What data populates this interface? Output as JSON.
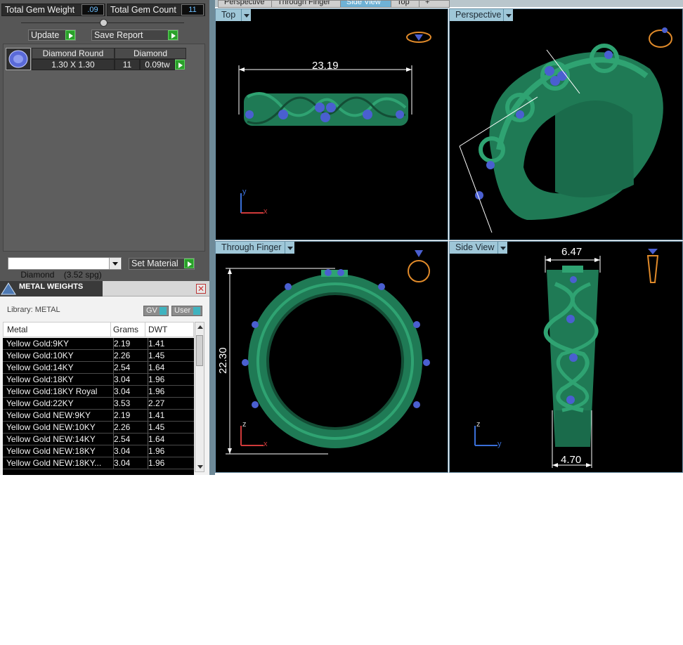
{
  "tabs": [
    "Perspective",
    "Through Finger",
    "Side View",
    "Top",
    "+"
  ],
  "gem_summary": {
    "weight_label": "Total Gem Weight",
    "weight_value": ".09",
    "count_label": "Total Gem Count",
    "count_value": "11"
  },
  "toolbar": {
    "update_label": "Update",
    "save_report_label": "Save Report"
  },
  "gem_table": {
    "shape_header": "Diamond Round",
    "shape_value": "1.30 X 1.30",
    "type_header": "Diamond",
    "count_value": "11",
    "weight_value": "0.09tw"
  },
  "material": {
    "selected": "Diamond    (3.52 spg)",
    "set_label": "Set Material"
  },
  "metal_weights": {
    "title": "METAL WEIGHTS",
    "library_label": "Library: METAL",
    "gv_label": "GV",
    "user_label": "User",
    "headers": [
      "Metal",
      "Grams",
      "DWT"
    ],
    "rows": [
      {
        "metal": "Yellow Gold:9KY",
        "grams": "2.19",
        "dwt": "1.41"
      },
      {
        "metal": "Yellow Gold:10KY",
        "grams": "2.26",
        "dwt": "1.45"
      },
      {
        "metal": "Yellow Gold:14KY",
        "grams": "2.54",
        "dwt": "1.64"
      },
      {
        "metal": "Yellow Gold:18KY",
        "grams": "3.04",
        "dwt": "1.96"
      },
      {
        "metal": "Yellow Gold:18KY Royal",
        "grams": "3.04",
        "dwt": "1.96"
      },
      {
        "metal": "Yellow Gold:22KY",
        "grams": "3.53",
        "dwt": "2.27"
      },
      {
        "metal": "Yellow Gold NEW:9KY",
        "grams": "2.19",
        "dwt": "1.41"
      },
      {
        "metal": "Yellow Gold NEW:10KY",
        "grams": "2.26",
        "dwt": "1.45"
      },
      {
        "metal": "Yellow Gold NEW:14KY",
        "grams": "2.54",
        "dwt": "1.64"
      },
      {
        "metal": "Yellow Gold NEW:18KY",
        "grams": "3.04",
        "dwt": "1.96"
      },
      {
        "metal": "Yellow Gold NEW:18KY...",
        "grams": "3.04",
        "dwt": "1.96"
      }
    ]
  },
  "viewports": {
    "top": {
      "label": "Top",
      "dimension": "23.19",
      "axis_v": "y",
      "axis_h": "x"
    },
    "perspective": {
      "label": "Perspective"
    },
    "through_finger": {
      "label": "Through Finger",
      "dimension": "22.30",
      "axis_v": "z",
      "axis_h": "x"
    },
    "side_view": {
      "label": "Side View",
      "dimension_top": "6.47",
      "dimension_bottom": "4.70",
      "axis_v": "z",
      "axis_h": "y"
    }
  },
  "colors": {
    "ring_green": "#1f7a55",
    "gem_blue": "#4a5fd0",
    "accent_blue": "#9fc7d8",
    "thumb_orange": "#e08a2a"
  }
}
